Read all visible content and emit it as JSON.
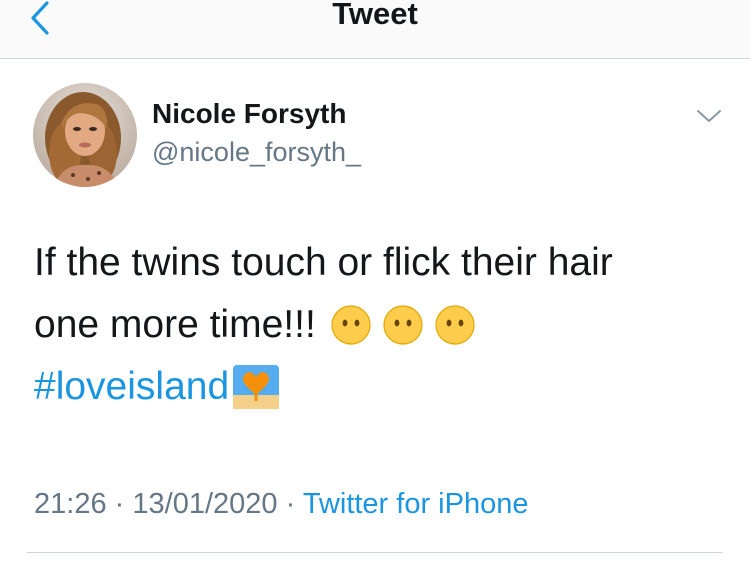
{
  "header": {
    "title": "Tweet",
    "back_icon": "chevron-left-icon"
  },
  "tweet": {
    "author_name": "Nicole Forsyth",
    "author_handle": "@nicole_forsyth_",
    "text_line_1": "If the twins touch or flick their hair",
    "text_line_2": "one more time!!!",
    "hashtag": "#loveisland",
    "emojis": [
      "face-without-mouth",
      "face-without-mouth",
      "face-without-mouth",
      "heart-on-beach"
    ],
    "time": "21:26",
    "separator": "·",
    "date": "13/01/2020",
    "source": "Twitter for iPhone"
  },
  "colors": {
    "link": "#1b95e0",
    "secondary": "#657786",
    "primary": "#14171a",
    "border": "#cfd5da"
  }
}
